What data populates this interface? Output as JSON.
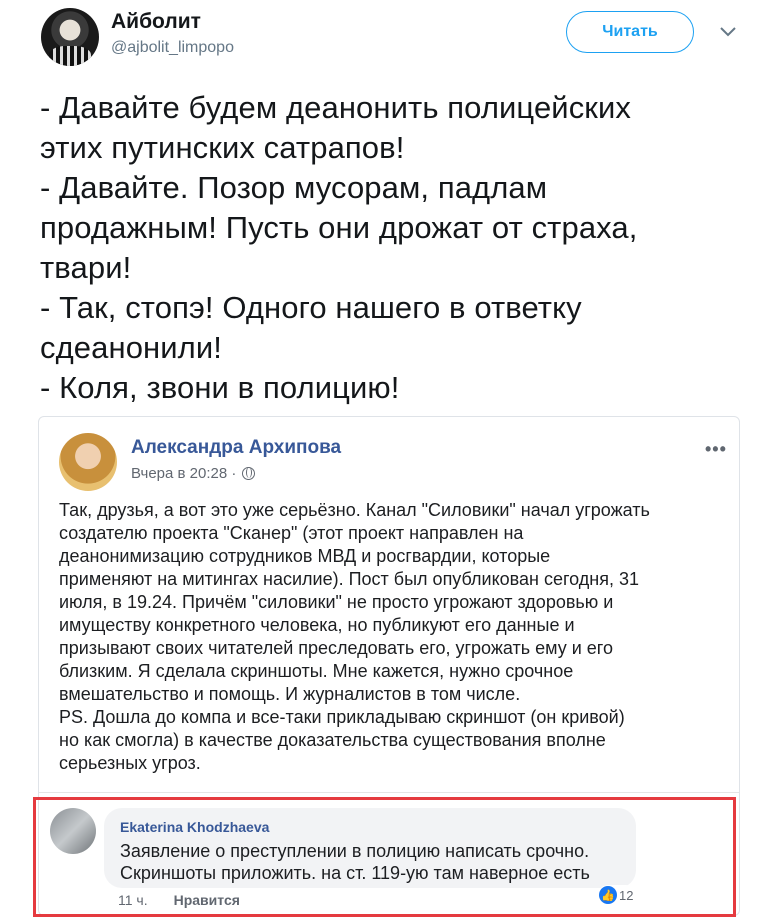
{
  "header": {
    "display_name": "Айболит",
    "handle": "@ajbolit_limpopo",
    "follow_label": "Читать"
  },
  "tweet": {
    "lines": [
      "- Давайте будем деанонить полицейских",
      "этих путинских сатрапов!",
      "- Давайте. Позор мусорам, падлам",
      "продажным! Пусть они дрожат от страха,",
      "твари!",
      "- Так, стопэ! Одного нашего в ответку",
      "сдеанонили!",
      "- Коля, звони в полицию!"
    ]
  },
  "embed": {
    "author": "Александра Архипова",
    "time": "Вчера в 20:28 ·",
    "more": "•••",
    "post_lines": [
      "Так, друзья, а вот это уже серьёзно. Канал \"Силовики\" начал угрожать",
      "создателю проекта \"Сканер\" (этот проект направлен на",
      "деанонимизацию сотрудников МВД и росгвардии, которые",
      "применяют на митингах насилие). Пост был опубликован сегодня, 31",
      "июля, в 19.24. Причём \"силовики\" не просто угрожают здоровью и",
      "имуществу конкретного человека, но публикуют его данные и",
      "призывают своих читателей преследовать его, угрожать ему и его",
      "близким. Я сделала скриншоты. Мне кажется, нужно срочное",
      "вмешательство и помощь. И журналистов в том числе.",
      "PS. Дошла до компа и  все-таки прикладываю скриншот (он кривой)",
      "но как смогла) в качестве доказательства существования вполне",
      "серьезных угроз."
    ]
  },
  "comment": {
    "author": "Ekaterina Khodzhaeva",
    "lines": [
      "Заявление о преступлении в полицию написать срочно.",
      "Скриншоты приложить. на ст. 119-ую там наверное есть"
    ],
    "time": "11 ч.",
    "like_label": "Нравится",
    "like_count": "12"
  },
  "colors": {
    "twitter_blue": "#1da1f2",
    "fb_link": "#385898",
    "highlight_red": "#e53a3f"
  }
}
